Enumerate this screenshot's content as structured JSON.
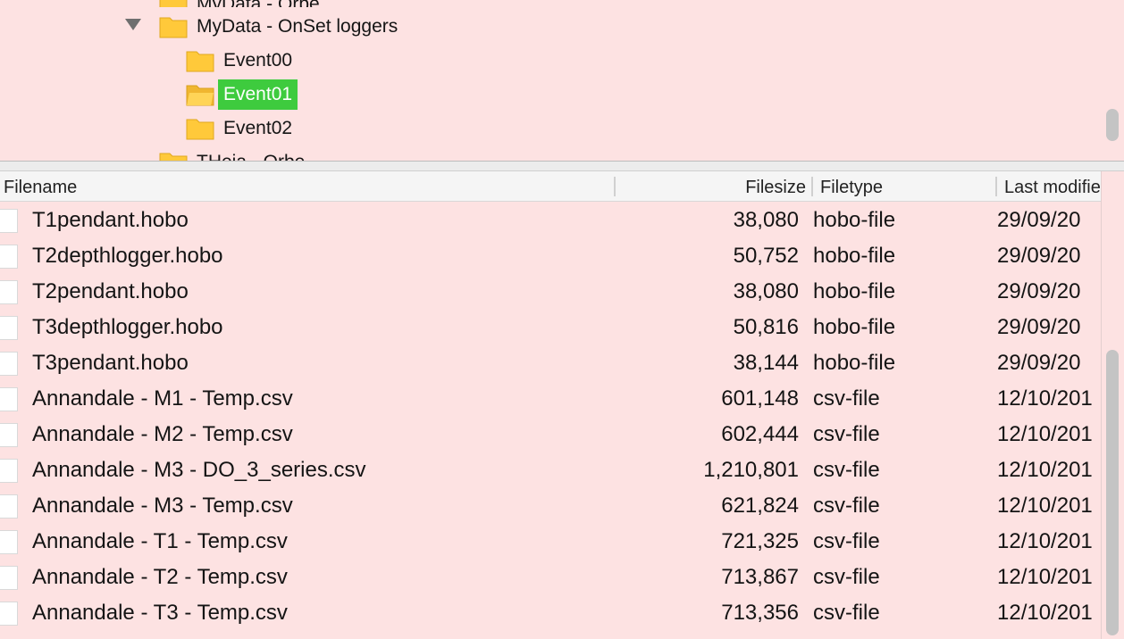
{
  "tree": {
    "top_partial_label": "MyData - Orbe",
    "parent": {
      "label": "MyData - OnSet loggers",
      "expanded": true
    },
    "children": [
      {
        "label": "Event00",
        "selected": false
      },
      {
        "label": "Event01",
        "selected": true
      },
      {
        "label": "Event02",
        "selected": false
      }
    ],
    "bottom_partial_label": "THeja - Orbe"
  },
  "colors": {
    "background": "#fde2e2",
    "selection": "#3ecb3e",
    "folder": "#ffc93a"
  },
  "list": {
    "columns": {
      "filename": "Filename",
      "filesize": "Filesize",
      "filetype": "Filetype",
      "last_modified": "Last modified"
    },
    "rows": [
      {
        "name": "T1pendant.hobo",
        "size": "38,080",
        "type": "hobo-file",
        "modified": "29/09/20"
      },
      {
        "name": "T2depthlogger.hobo",
        "size": "50,752",
        "type": "hobo-file",
        "modified": "29/09/20"
      },
      {
        "name": "T2pendant.hobo",
        "size": "38,080",
        "type": "hobo-file",
        "modified": "29/09/20"
      },
      {
        "name": "T3depthlogger.hobo",
        "size": "50,816",
        "type": "hobo-file",
        "modified": "29/09/20"
      },
      {
        "name": "T3pendant.hobo",
        "size": "38,144",
        "type": "hobo-file",
        "modified": "29/09/20"
      },
      {
        "name": "Annandale - M1 - Temp.csv",
        "size": "601,148",
        "type": "csv-file",
        "modified": "12/10/201"
      },
      {
        "name": "Annandale - M2 - Temp.csv",
        "size": "602,444",
        "type": "csv-file",
        "modified": "12/10/201"
      },
      {
        "name": "Annandale - M3 - DO_3_series.csv",
        "size": "1,210,801",
        "type": "csv-file",
        "modified": "12/10/201"
      },
      {
        "name": "Annandale - M3 - Temp.csv",
        "size": "621,824",
        "type": "csv-file",
        "modified": "12/10/201"
      },
      {
        "name": "Annandale - T1 - Temp.csv",
        "size": "721,325",
        "type": "csv-file",
        "modified": "12/10/201"
      },
      {
        "name": "Annandale - T2 - Temp.csv",
        "size": "713,867",
        "type": "csv-file",
        "modified": "12/10/201"
      },
      {
        "name": "Annandale - T3 - Temp.csv",
        "size": "713,356",
        "type": "csv-file",
        "modified": "12/10/201"
      }
    ]
  }
}
